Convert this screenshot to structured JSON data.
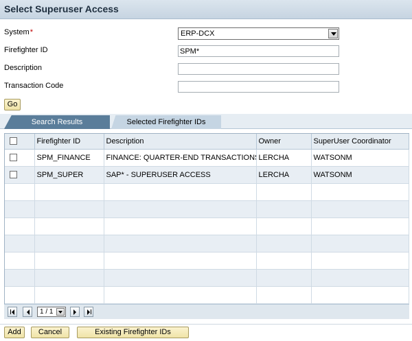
{
  "title": "Select Superuser Access",
  "form": {
    "system_label": "System",
    "required_mark": "*",
    "system_value": "ERP-DCX",
    "firefighter_id_label": "Firefighter ID",
    "firefighter_id_value": "SPM*",
    "description_label": "Description",
    "description_value": "",
    "transaction_code_label": "Transaction Code",
    "transaction_code_value": "",
    "go_label": "Go"
  },
  "tabs": [
    {
      "label": "Search Results",
      "active": true
    },
    {
      "label": "Selected Firefighter IDs",
      "active": false
    }
  ],
  "table": {
    "columns": [
      "Firefighter ID",
      "Description",
      "Owner",
      "SuperUser Coordinator"
    ],
    "rows": [
      {
        "firefighter_id": "SPM_FINANCE",
        "description": "FINANCE: QUARTER-END TRANSACTIONS",
        "owner": "LERCHA",
        "coordinator": "WATSONM"
      },
      {
        "firefighter_id": "SPM_SUPER",
        "description": "SAP* - SUPERUSER ACCESS",
        "owner": "LERCHA",
        "coordinator": "WATSONM"
      }
    ]
  },
  "pager": {
    "page_value": "1 / 1"
  },
  "footer": {
    "add_label": "Add",
    "cancel_label": "Cancel",
    "existing_label": "Existing Firefighter IDs"
  },
  "colors": {
    "title_bg": "#c6d4e1",
    "tab_active": "#5a7d9a",
    "tab_inactive": "#c5d5e3",
    "button_bg": "#efe3a7",
    "row_alt": "#e8eef4"
  }
}
